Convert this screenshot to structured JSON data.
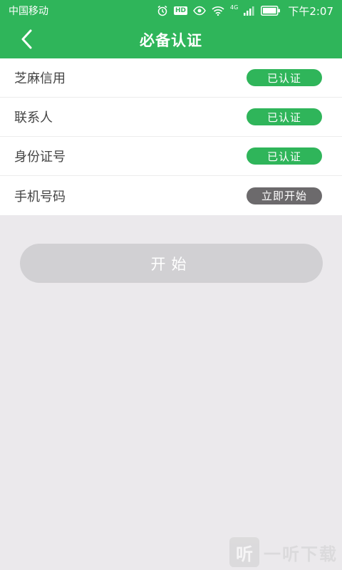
{
  "status_bar": {
    "carrier": "中国移动",
    "hd_label": "HD",
    "network_label": "4G",
    "time": "下午2:07"
  },
  "header": {
    "title": "必备认证",
    "back_icon": "chevron-left-icon"
  },
  "verification_items": [
    {
      "label": "芝麻信用",
      "status": "已认证",
      "state": "verified"
    },
    {
      "label": "联系人",
      "status": "已认证",
      "state": "verified"
    },
    {
      "label": "身份证号",
      "status": "已认证",
      "state": "verified"
    },
    {
      "label": "手机号码",
      "status": "立即开始",
      "state": "pending"
    }
  ],
  "start_button": {
    "label": "开始"
  },
  "watermark": {
    "logo_text": "听",
    "text": "一听下载"
  },
  "colors": {
    "brand_green": "#2fb55a",
    "pending_gray": "#6c6a6c",
    "disabled_button": "#d1d0d3",
    "page_background": "#ebe9ec"
  }
}
